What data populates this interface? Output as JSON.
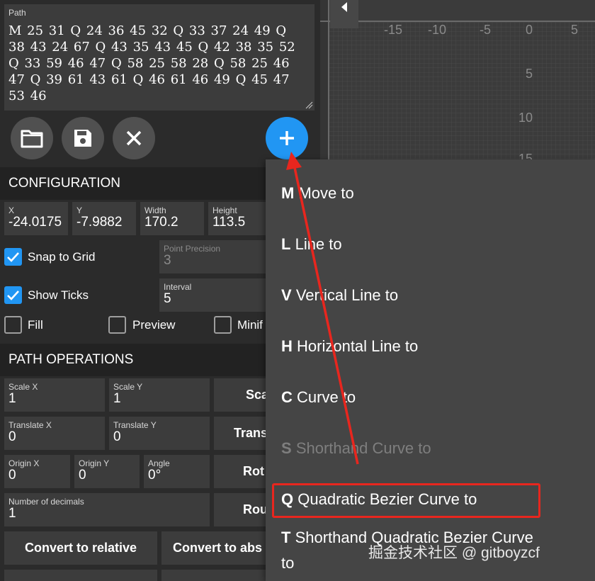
{
  "path_editor": {
    "label": "Path",
    "value": "M 25 31 Q 24 36 45 32 Q 33 37 24 49 Q 38 43 24 67 Q 43 35 43 45 Q 42 38 35 52 Q 33 59 46 47 Q 58 25 58 28 Q 58 25 46 47 Q 39 61 43 61 Q 46 61 46 49 Q 45 47 53 46"
  },
  "toolbar": {
    "open_icon": "folder-icon",
    "save_icon": "floppy-disk-icon",
    "clear_icon": "close-icon",
    "add_icon": "plus-icon"
  },
  "configuration": {
    "title": "CONFIGURATION",
    "x": {
      "label": "X",
      "value": "-24.0175"
    },
    "y": {
      "label": "Y",
      "value": "-7.9882"
    },
    "width": {
      "label": "Width",
      "value": "170.2"
    },
    "height": {
      "label": "Height",
      "value": "113.5"
    },
    "snap_to_grid": {
      "label": "Snap to Grid",
      "checked": true
    },
    "show_ticks": {
      "label": "Show Ticks",
      "checked": true
    },
    "point_precision": {
      "label": "Point Precision",
      "value": "3"
    },
    "interval": {
      "label": "Interval",
      "value": "5"
    },
    "fill": {
      "label": "Fill",
      "checked": false
    },
    "preview": {
      "label": "Preview",
      "checked": false
    },
    "minify": {
      "label": "Minif",
      "checked": false
    }
  },
  "path_operations": {
    "title": "PATH OPERATIONS",
    "scale_x": {
      "label": "Scale X",
      "value": "1"
    },
    "scale_y": {
      "label": "Scale Y",
      "value": "1"
    },
    "scale_button": "Sca",
    "translate_x": {
      "label": "Translate X",
      "value": "0"
    },
    "translate_y": {
      "label": "Translate Y",
      "value": "0"
    },
    "translate_button": "Trans",
    "origin_x": {
      "label": "Origin X",
      "value": "0"
    },
    "origin_y": {
      "label": "Origin Y",
      "value": "0"
    },
    "angle": {
      "label": "Angle",
      "value": "0°"
    },
    "rotate_button": "Rot",
    "decimals": {
      "label": "Number of decimals",
      "value": "1"
    },
    "round_button": "Rou",
    "convert_relative": "Convert to relative",
    "convert_absolute": "Convert to abs"
  },
  "canvas": {
    "x_ticks": [
      "-15",
      "-10",
      "-5",
      "0",
      "5"
    ],
    "y_ticks": [
      "5",
      "10",
      "15"
    ]
  },
  "add_menu": {
    "items": [
      {
        "key": "M",
        "label": "Move to",
        "enabled": true
      },
      {
        "key": "L",
        "label": "Line to",
        "enabled": true
      },
      {
        "key": "V",
        "label": "Vertical Line to",
        "enabled": true
      },
      {
        "key": "H",
        "label": "Horizontal Line to",
        "enabled": true
      },
      {
        "key": "C",
        "label": "Curve to",
        "enabled": true
      },
      {
        "key": "S",
        "label": "Shorthand Curve to",
        "enabled": false
      },
      {
        "key": "Q",
        "label": "Quadratic Bezier Curve to",
        "enabled": true
      },
      {
        "key": "T",
        "label": "Shorthand Quadratic Bezier Curve",
        "label2": "to",
        "enabled": true
      }
    ]
  },
  "annotation": {
    "highlight_color": "#e8261e",
    "arrow_color": "#e8261e"
  },
  "watermark": "掘金技术社区 @ gitboyzcf",
  "colors": {
    "accent": "#2196f3",
    "panel": "#2b2b2b",
    "field": "#3c3c3c",
    "menu": "#454545"
  }
}
